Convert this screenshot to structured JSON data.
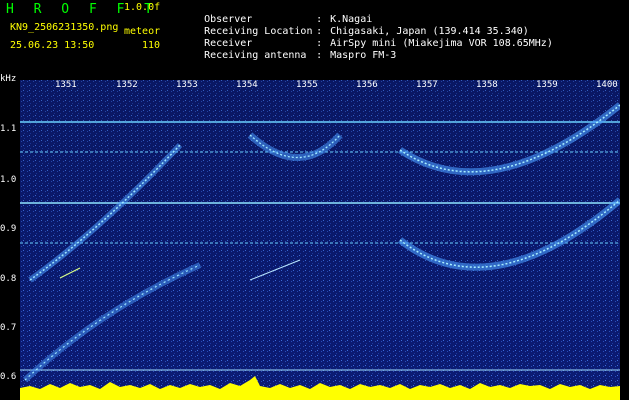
{
  "header": {
    "brand": "H R O F F T",
    "version": "1.0.0f",
    "filename": "KN9_2506231350.png",
    "meteor_label": "meteor",
    "datetime": "25.06.23 13:50",
    "count": "110",
    "observer_key": "Observer",
    "observer_val": "K.Nagai",
    "location_key": "Receiving Location",
    "location_val": "Chigasaki, Japan (139.414 35.340)",
    "receiver_key": "Receiver",
    "receiver_val": "AirSpy mini (Miakejima VOR 108.65MHz)",
    "antenna_key": "Receiving antenna",
    "antenna_val": "Maspro FM-3",
    "separator": ":"
  },
  "axes": {
    "y_unit": "kHz",
    "y_ticks": [
      "1.1",
      "1.0",
      "0.9",
      "0.8",
      "0.7",
      "0.6"
    ],
    "x_ticks": [
      "1351",
      "1352",
      "1353",
      "1354",
      "1355",
      "1356",
      "1357",
      "1358",
      "1359",
      "1400"
    ]
  },
  "colors": {
    "background": "#000000",
    "spectrogram_base": "#0a1a70",
    "trace": "#8fd8ff",
    "noise_floor": "#ffff00"
  }
}
